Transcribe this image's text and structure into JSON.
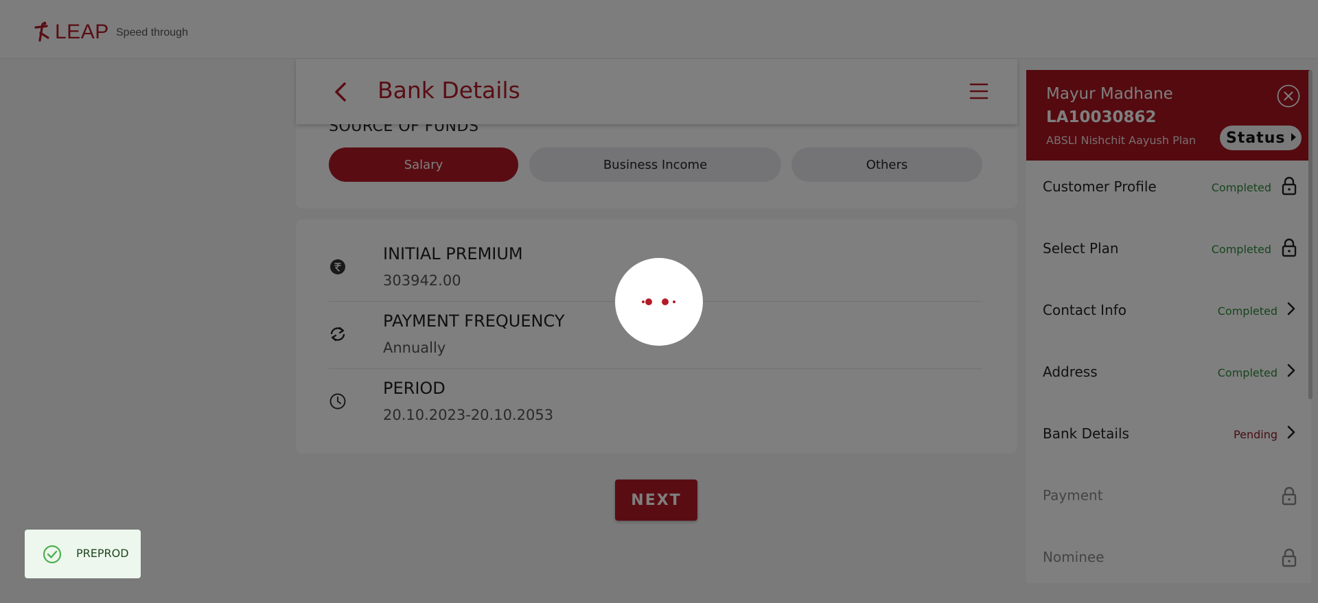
{
  "header": {
    "brand": "LEAP",
    "tagline": "Speed through"
  },
  "page": {
    "title": "Bank Details",
    "back_icon": "chevron-left-icon",
    "menu_icon": "hamburger-icon"
  },
  "source_of_funds": {
    "label": "SOURCE OF FUNDS",
    "options": [
      {
        "label": "Salary",
        "selected": true
      },
      {
        "label": "Business Income",
        "selected": false
      },
      {
        "label": "Others",
        "selected": false
      }
    ]
  },
  "summary": [
    {
      "icon": "rupee-icon",
      "title": "INITIAL PREMIUM",
      "value": "303942.00"
    },
    {
      "icon": "refresh-icon",
      "title": "PAYMENT FREQUENCY",
      "value": "Annually"
    },
    {
      "icon": "clock-icon",
      "title": "PERIOD",
      "value": "20.10.2023-20.10.2053"
    }
  ],
  "next_button": "NEXT",
  "status_panel": {
    "customer_name": "Mayur Madhane",
    "application_no": "LA10030862",
    "plan": "ABSLI Nishchit Aayush Plan",
    "status_label": "Status",
    "steps": [
      {
        "label": "Customer Profile",
        "status": "Completed",
        "icon": "lock-icon"
      },
      {
        "label": "Select Plan",
        "status": "Completed",
        "icon": "lock-icon"
      },
      {
        "label": "Contact Info",
        "status": "Completed",
        "icon": "chevron-right-icon"
      },
      {
        "label": "Address",
        "status": "Completed",
        "icon": "chevron-right-icon"
      },
      {
        "label": "Bank Details",
        "status": "Pending",
        "icon": "chevron-right-icon"
      },
      {
        "label": "Payment",
        "status": "",
        "icon": "lock-icon"
      },
      {
        "label": "Nominee",
        "status": "",
        "icon": "lock-icon"
      }
    ]
  },
  "toast": {
    "text": "PREPROD",
    "icon": "check-circle-icon"
  },
  "colors": {
    "brand": "#b31b27",
    "panel_header": "#a8141f",
    "completed": "#2e8b3b",
    "pending": "#8c1d26"
  }
}
